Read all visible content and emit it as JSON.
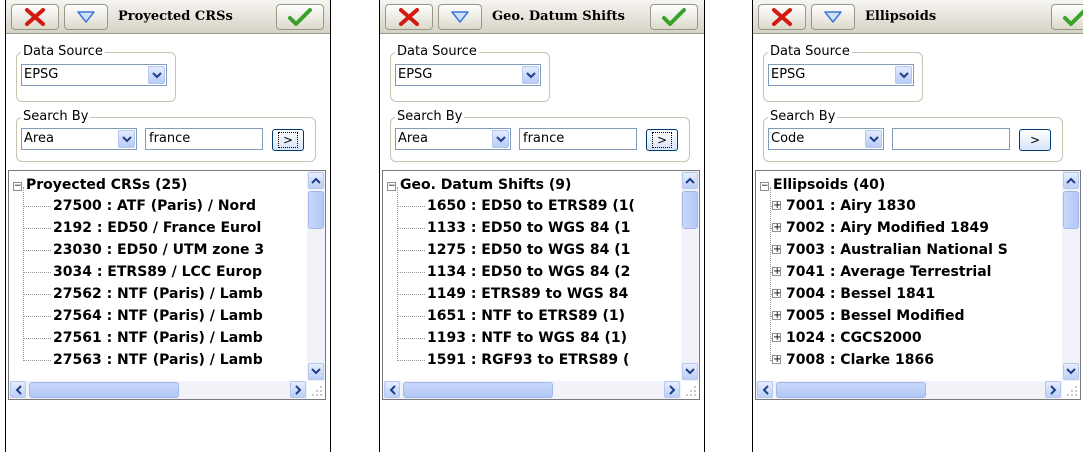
{
  "colors": {
    "close": "#d21a12",
    "ok": "#3aa22a",
    "menu": "#3c78d8",
    "scroll": "#b8cbf5"
  },
  "panels": [
    {
      "title": "Proyected CRSs",
      "data_source_label": "Data Source",
      "data_source_value": "EPSG",
      "search_by_label": "Search By",
      "search_by_value": "Area",
      "search_text": "france",
      "search_button": ">",
      "tree_root": "Proyected CRSs (25)",
      "items": [
        "27500 : ATF (Paris) / Nord",
        "2192 : ED50 / France Eurol",
        "23030 : ED50 / UTM zone 3",
        "3034 : ETRS89 / LCC Europ",
        "27562 : NTF (Paris) / Lamb",
        "27564 : NTF (Paris) / Lamb",
        "27561 : NTF (Paris) / Lamb",
        "27563 : NTF (Paris) / Lamb"
      ]
    },
    {
      "title": "Geo. Datum Shifts",
      "data_source_label": "Data Source",
      "data_source_value": "EPSG",
      "search_by_label": "Search By",
      "search_by_value": "Area",
      "search_text": "france",
      "search_button": ">",
      "tree_root": "Geo. Datum Shifts (9)",
      "items": [
        "1650 : ED50 to ETRS89 (1(",
        "1133 : ED50 to WGS 84 (1",
        "1275 : ED50 to WGS 84 (1",
        "1134 : ED50 to WGS 84 (2",
        "1149 : ETRS89 to WGS 84",
        "1651 : NTF to ETRS89 (1)",
        "1193 : NTF to WGS 84 (1)",
        "1591 : RGF93 to ETRS89 ("
      ]
    },
    {
      "title": "Ellipsoids",
      "data_source_label": "Data Source",
      "data_source_value": "EPSG",
      "search_by_label": "Search By",
      "search_by_value": "Code",
      "search_text": "",
      "search_button": ">",
      "tree_root": "Ellipsoids (40)",
      "items": [
        "7001 : Airy 1830",
        "7002 : Airy Modified 1849",
        "7003 : Australian National S",
        "7041 : Average Terrestrial",
        "7004 : Bessel 1841",
        "7005 : Bessel Modified",
        "1024 : CGCS2000",
        "7008 : Clarke 1866"
      ]
    }
  ]
}
